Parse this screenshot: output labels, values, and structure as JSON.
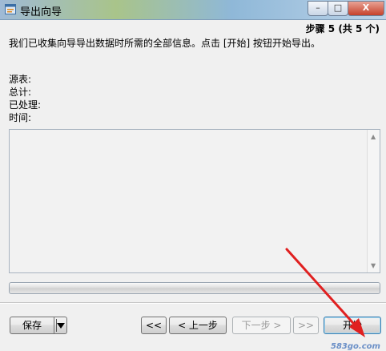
{
  "window": {
    "title": "导出向导",
    "controls": {
      "minimize": "–",
      "maximize": "□",
      "close": "X"
    }
  },
  "wizard": {
    "step": "步骤 5 (共 5 个)",
    "description": "我们已收集向导导出数据时所需的全部信息。点击 [开始] 按钮开始导出。",
    "info": {
      "source_label": "源表:",
      "total_label": "总计:",
      "processed_label": "已处理:",
      "time_label": "时间:"
    },
    "log": {
      "scroll_up": "▲",
      "scroll_down": "▼"
    },
    "progress": 0
  },
  "buttons": {
    "save": "保存",
    "first": "<<",
    "prev": "< 上一步",
    "next": "下一步 >",
    "last": ">>",
    "start": "开始"
  },
  "watermark": "583go.com",
  "colors": {
    "arrow": "#e02020",
    "title_gradient_start": "#9fbad6",
    "close_button": "#c6412b"
  },
  "icons": {
    "app": "export-wizard-icon",
    "dropdown": "dropdown-arrow-icon"
  }
}
